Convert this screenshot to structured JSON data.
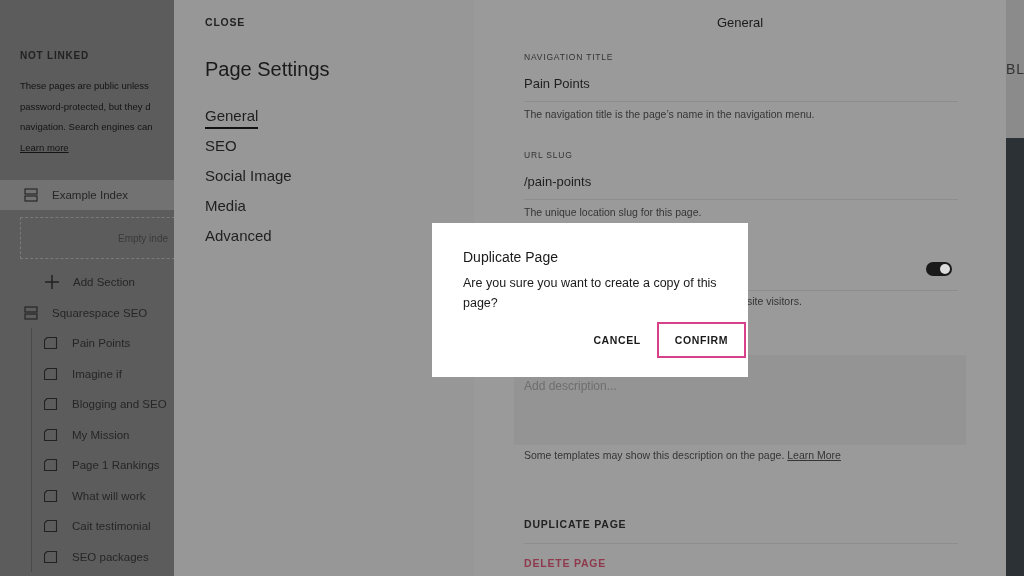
{
  "sidebar": {
    "heading": "NOT LINKED",
    "description_lines": [
      "These pages are public unless",
      "password-protected, but they d",
      "navigation. Search engines can"
    ],
    "learn_more": "Learn more",
    "items": [
      {
        "kind": "section",
        "label": "Example Index",
        "selected": true,
        "children": [
          {
            "kind": "empty",
            "label": "Empty inde"
          }
        ]
      },
      {
        "kind": "add",
        "label": "Add Section",
        "selected": false
      },
      {
        "kind": "section",
        "label": "Squarespace SEO",
        "selected": false,
        "children": [
          {
            "kind": "page",
            "label": "Pain Points"
          },
          {
            "kind": "page",
            "label": "Imagine if"
          },
          {
            "kind": "page",
            "label": "Blogging and SEO"
          },
          {
            "kind": "page",
            "label": "My Mission"
          },
          {
            "kind": "page",
            "label": "Page 1 Rankings"
          },
          {
            "kind": "page",
            "label": "What will work"
          },
          {
            "kind": "page",
            "label": "Cait testimonial"
          },
          {
            "kind": "page",
            "label": "SEO packages"
          }
        ]
      }
    ]
  },
  "settings_nav": {
    "close": "CLOSE",
    "title": "Page Settings",
    "tabs": [
      {
        "label": "General",
        "selected": true
      },
      {
        "label": "SEO",
        "selected": false
      },
      {
        "label": "Social Image",
        "selected": false
      },
      {
        "label": "Media",
        "selected": false
      },
      {
        "label": "Advanced",
        "selected": false
      }
    ]
  },
  "general_panel": {
    "title": "General",
    "fields": [
      {
        "kind": "text",
        "label": "NAVIGATION TITLE",
        "value": "Pain Points",
        "hint": "The navigation title is the page’s name in the navigation menu."
      },
      {
        "kind": "text",
        "label": "URL SLUG",
        "value": "/pain-points",
        "hint": "The unique location slug for this page."
      },
      {
        "kind": "toggle",
        "on": true,
        "hint": "site visitors."
      },
      {
        "kind": "textarea",
        "placeholder": "Add description...",
        "hint": "Some templates may show this description on the page.",
        "link": "Learn More"
      }
    ],
    "actions": [
      {
        "kind": "normal",
        "label": "DUPLICATE PAGE"
      },
      {
        "kind": "danger",
        "label": "DELETE PAGE"
      }
    ]
  },
  "background_page": {
    "text": "BL"
  },
  "dialog": {
    "title": "Duplicate Page",
    "message": "Are you sure you want to create a copy of this page?",
    "buttons": [
      {
        "label": "CANCEL",
        "highlighted": false
      },
      {
        "label": "CONFIRM",
        "highlighted": true
      }
    ]
  }
}
